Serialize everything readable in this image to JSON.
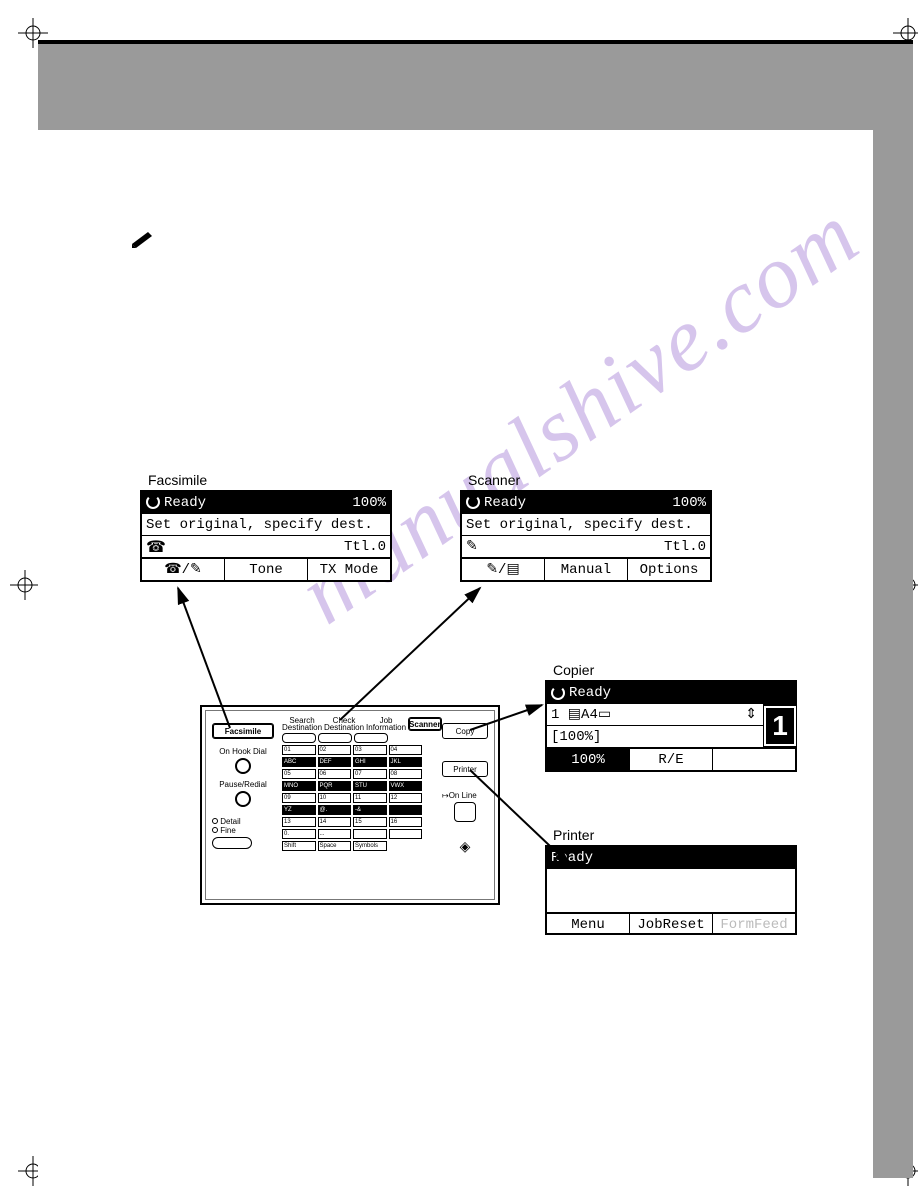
{
  "watermark": "manualshive.com",
  "facsimile": {
    "title": "Facsimile",
    "status": "Ready",
    "percent": "100%",
    "line2": "Set original, specify dest.",
    "line3_right": "Ttl.0",
    "buttons": {
      "b1_icon": "☎/✎",
      "b2": "Tone",
      "b3": "TX Mode"
    }
  },
  "scanner": {
    "title": "Scanner",
    "status": "Ready",
    "percent": "100%",
    "line2": "Set original, specify dest.",
    "line3_right": "Ttl.0",
    "buttons": {
      "b1_icon": "✎/▤",
      "b2": "Manual",
      "b3": "Options"
    }
  },
  "copier": {
    "title": "Copier",
    "status": "Ready",
    "line2_left": "1",
    "line2_paper": "A4",
    "line2_arrows": "⇕",
    "line3": "[100%]",
    "big_digit": "1",
    "buttons": {
      "b1": "100%",
      "b2": "R/E",
      "b3": ""
    }
  },
  "printer": {
    "title": "Printer",
    "status": "Ready",
    "buttons": {
      "b1": "Menu",
      "b2": "JobReset",
      "b3": "FormFeed"
    }
  },
  "panel": {
    "facsimile_btn": "Facsimile",
    "scanner_btn": "Scanner",
    "copy_btn": "Copy",
    "printer_btn": "Printer",
    "on_hook": "On Hook Dial",
    "pause_redial": "Pause/Redial",
    "detail": "Detail",
    "fine": "Fine",
    "top_labels": {
      "a": "Search Destination",
      "b": "Check Destination",
      "c": "Job Information"
    },
    "on_line": "On Line",
    "key_rows": [
      [
        "01",
        "02",
        "03",
        "04"
      ],
      [
        "ABC",
        "DEF",
        "GHI",
        "JKL"
      ],
      [
        "05",
        "06",
        "07",
        "08"
      ],
      [
        "MNO",
        "PQR",
        "STU",
        "VWX"
      ],
      [
        "09",
        "10",
        "11",
        "12"
      ],
      [
        "YZ",
        "@.",
        "-&",
        ""
      ],
      [
        "13",
        "14",
        "15",
        "16"
      ],
      [
        "0.",
        "...",
        "",
        ""
      ],
      [
        "Shift",
        "Space",
        "Symbols",
        ""
      ]
    ]
  }
}
